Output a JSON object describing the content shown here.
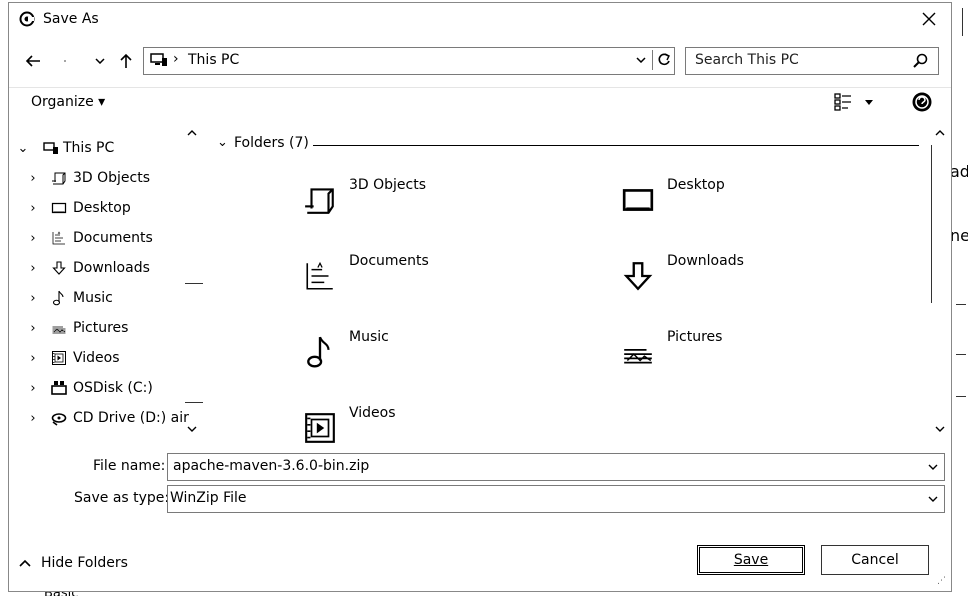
{
  "window": {
    "title": "Save As"
  },
  "nav": {
    "address_path": "This PC",
    "search_placeholder": "Search This PC"
  },
  "toolbar": {
    "organize_label": "Organize ▾"
  },
  "tree": {
    "root": "This PC",
    "items": [
      {
        "label": "3D Objects",
        "icon": "cube-icon"
      },
      {
        "label": "Desktop",
        "icon": "desktop-icon"
      },
      {
        "label": "Documents",
        "icon": "document-icon"
      },
      {
        "label": "Downloads",
        "icon": "download-icon"
      },
      {
        "label": "Music",
        "icon": "music-note-icon"
      },
      {
        "label": "Pictures",
        "icon": "picture-icon"
      },
      {
        "label": "Videos",
        "icon": "video-icon"
      },
      {
        "label": "OSDisk (C:)",
        "icon": "drive-icon"
      },
      {
        "label": "CD Drive (D:) air",
        "icon": "cd-drive-icon"
      }
    ]
  },
  "content": {
    "group_header": "Folders (7)",
    "folders": [
      {
        "label": "3D Objects",
        "icon": "cube-icon"
      },
      {
        "label": "Desktop",
        "icon": "desktop-icon"
      },
      {
        "label": "Documents",
        "icon": "document-icon"
      },
      {
        "label": "Downloads",
        "icon": "download-icon"
      },
      {
        "label": "Music",
        "icon": "music-note-icon"
      },
      {
        "label": "Pictures",
        "icon": "picture-icon"
      },
      {
        "label": "Videos",
        "icon": "video-icon"
      }
    ]
  },
  "form": {
    "file_name_label": "File name:",
    "file_name_value": "apache-maven-3.6.0-bin.zip",
    "save_type_label": "Save as type:",
    "save_type_value": "WinZip File"
  },
  "footer": {
    "hide_folders_label": "Hide Folders",
    "save_label": "Save",
    "cancel_label": "Cancel"
  },
  "background": {
    "frag1": "ad",
    "frag2": "ne",
    "frag3": "Basic"
  }
}
